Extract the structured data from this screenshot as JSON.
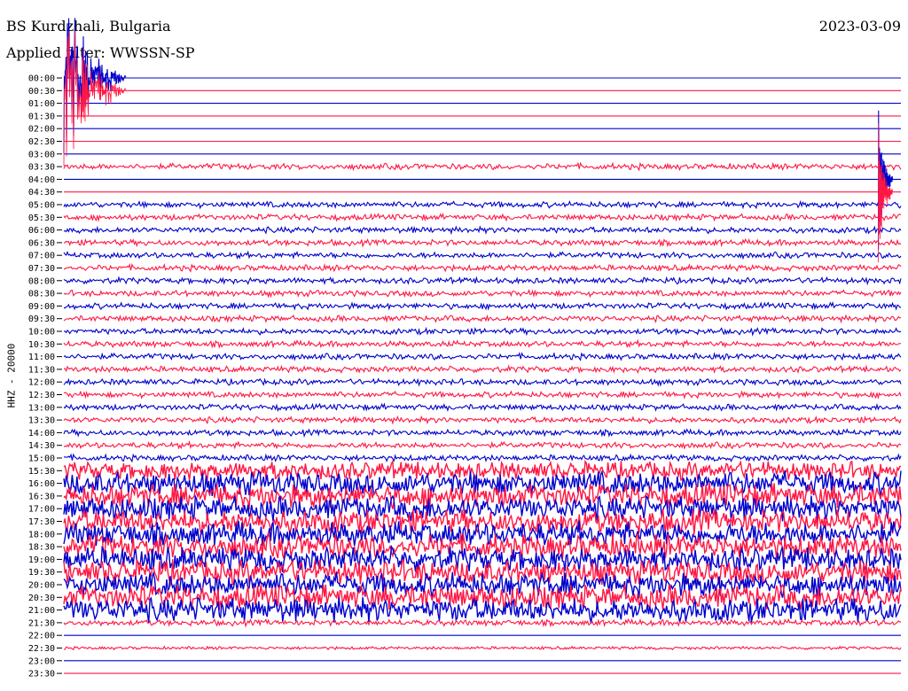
{
  "header": {
    "station": "BS Kurdzhali, Bulgaria",
    "filter": "Applied filter: WWSSN-SP",
    "date": "2023-03-09"
  },
  "chart_data": {
    "type": "line",
    "title": "BS Kurdzhali, Bulgaria",
    "subtitle": "Applied filter: WWSSN-SP",
    "date": "2023-03-09",
    "ylabel": "HHZ - 20000",
    "y_ticks": [
      "00:00",
      "00:30",
      "01:00",
      "01:30",
      "02:00",
      "02:30",
      "03:00",
      "03:30",
      "04:00",
      "04:30",
      "05:00",
      "05:30",
      "06:00",
      "06:30",
      "07:00",
      "07:30",
      "08:00",
      "08:30",
      "09:00",
      "09:30",
      "10:00",
      "10:30",
      "11:00",
      "11:30",
      "12:00",
      "12:30",
      "13:00",
      "13:30",
      "14:00",
      "14:30",
      "15:00",
      "15:30",
      "16:00",
      "16:30",
      "17:00",
      "17:30",
      "18:00",
      "18:30",
      "19:00",
      "19:30",
      "20:00",
      "20:30",
      "21:00",
      "21:30",
      "22:00",
      "22:30",
      "23:00",
      "23:30"
    ],
    "trace_colors": [
      "#0000cc",
      "#ff1744"
    ],
    "trace_noise_level": [
      0,
      0,
      0,
      0,
      0,
      0,
      0,
      1,
      0,
      0,
      1,
      1,
      1,
      1,
      1,
      1,
      1,
      1,
      1,
      1,
      1,
      1,
      1,
      1,
      1,
      1,
      1,
      1,
      1,
      1,
      1,
      3,
      4,
      4,
      4,
      4,
      4,
      4,
      4,
      4,
      4,
      4,
      4,
      1,
      0,
      0.5,
      0,
      0
    ],
    "events": [
      {
        "label": "teleseismic event",
        "trace": "00:00",
        "x_fraction": 0.0,
        "amplitude": "large"
      },
      {
        "label": "local event",
        "trace": "04:00",
        "x_fraction": 0.99,
        "amplitude": "large"
      }
    ]
  }
}
